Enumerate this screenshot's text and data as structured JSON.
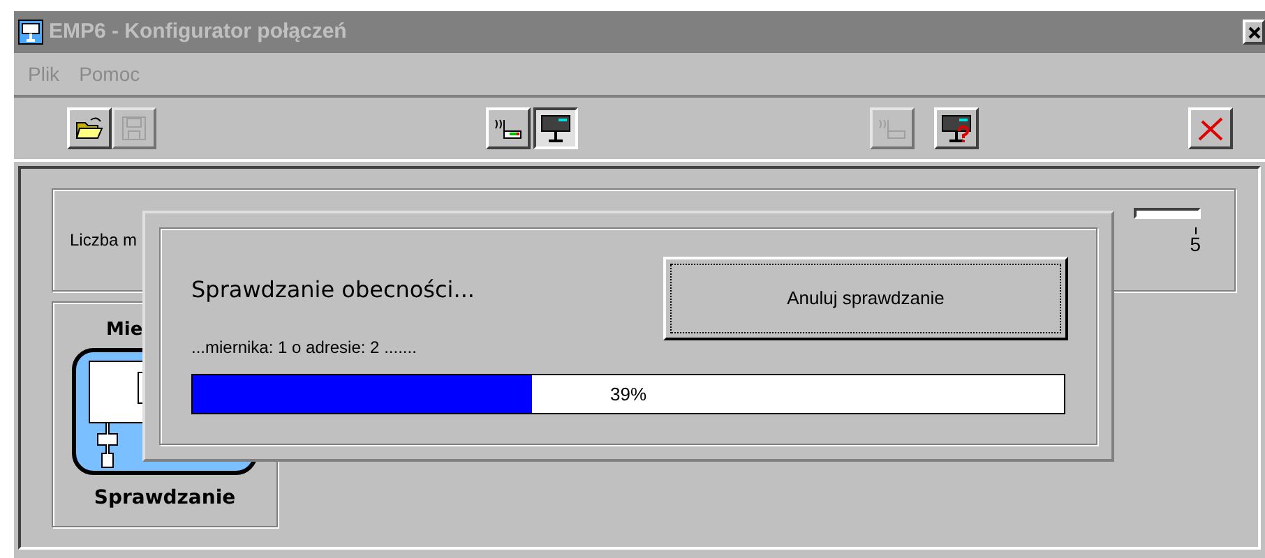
{
  "window": {
    "title": "EMP6 - Konfigurator połączeń"
  },
  "menu": [
    {
      "label": "Plik",
      "disabled": true
    },
    {
      "label": "Pomoc",
      "disabled": true
    }
  ],
  "toolbar": [
    {
      "kind": "open",
      "disabled": false,
      "pressed": false
    },
    {
      "kind": "save",
      "disabled": true,
      "pressed": false
    },
    {
      "kind": "link",
      "disabled": false,
      "pressed": false
    },
    {
      "kind": "monitor",
      "disabled": false,
      "pressed": true
    },
    {
      "kind": "link",
      "disabled": true,
      "pressed": false
    },
    {
      "kind": "monitor-query",
      "disabled": false,
      "pressed": false
    },
    {
      "kind": "disconnect",
      "disabled": false,
      "pressed": false
    }
  ],
  "count_group": {
    "label": "Liczba m",
    "scale_max": "5"
  },
  "meter_group": {
    "title": "Mie",
    "caption": "Sprawdzanie"
  },
  "dialog": {
    "title": "Sprawdzanie obecności...",
    "status": "...miernika: 1 o adresie: 2 .......",
    "cancel_button": "Anuluj sprawdzanie",
    "progress": {
      "level": 0.39,
      "label": "39%"
    }
  }
}
